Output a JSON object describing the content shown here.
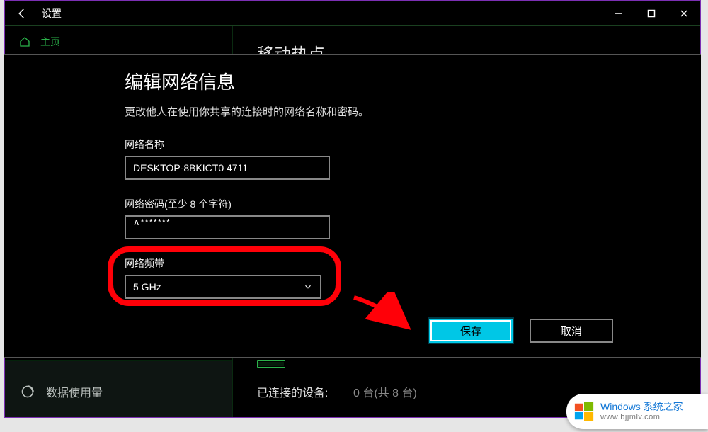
{
  "titlebar": {
    "title": "设置"
  },
  "sidebar": {
    "home_label": "主页",
    "data_usage_label": "数据使用量"
  },
  "main": {
    "page_title": "移动热点",
    "connected_label": "已连接的设备:",
    "connected_value": "0 台(共 8 台)"
  },
  "dialog": {
    "title": "编辑网络信息",
    "description": "更改他人在使用你共享的连接时的网络名称和密码。",
    "network_name_label": "网络名称",
    "network_name_value": "DESKTOP-8BKICT0 4711",
    "network_password_label": "网络密码(至少 8 个字符)",
    "network_password_value": "∧*******",
    "network_band_label": "网络频带",
    "network_band_value": "5 GHz",
    "save_label": "保存",
    "cancel_label": "取消"
  },
  "watermark": {
    "brand": "Windows 系统之家",
    "url": "www.bjjmlv.com"
  }
}
